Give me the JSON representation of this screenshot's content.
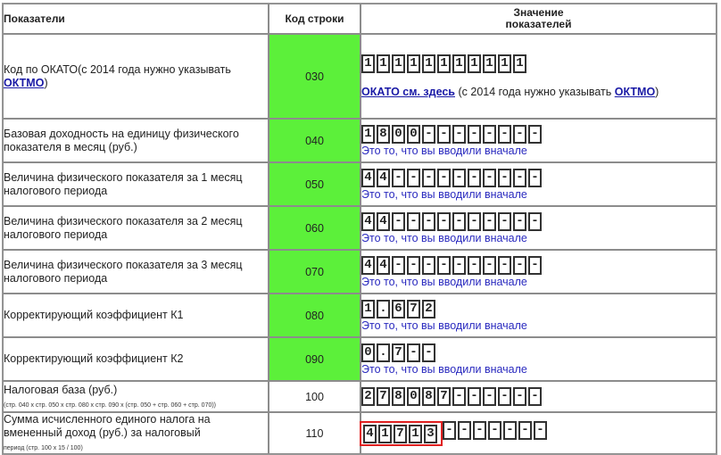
{
  "header": {
    "col1": "Показатели",
    "col2": "Код строки",
    "col3_line1": "Значение",
    "col3_line2": "показателей"
  },
  "okato": {
    "label_prefix": "Код по ОКАТО(с 2014 года нужно указывать ",
    "label_link": "ОКТМО",
    "label_suffix": ")",
    "code": "030",
    "cells": [
      "1",
      "1",
      "1",
      "1",
      "1",
      "1",
      "1",
      "1",
      "1",
      "1",
      "1"
    ],
    "link_text": "ОКАТО см. здесь",
    "after_text": "(с 2014 года нужно указывать ",
    "after_link": "ОКТМО",
    "after_suffix": ")"
  },
  "hint_text": "Это то, что вы вводили вначале",
  "rows": [
    {
      "label": "Базовая доходность на единицу физического показателя в месяц (руб.)",
      "code": "040",
      "cells": [
        "1",
        "8",
        "0",
        "0",
        "-",
        "-",
        "-",
        "-",
        "-",
        "-",
        "-",
        "-"
      ]
    },
    {
      "label": "Величина физического показателя за 1 месяц налогового периода",
      "code": "050",
      "cells": [
        "4",
        "4",
        "-",
        "-",
        "-",
        "-",
        "-",
        "-",
        "-",
        "-",
        "-",
        "-"
      ]
    },
    {
      "label": "Величина физического показателя за 2 месяц налогового периода",
      "code": "060",
      "cells": [
        "4",
        "4",
        "-",
        "-",
        "-",
        "-",
        "-",
        "-",
        "-",
        "-",
        "-",
        "-"
      ]
    },
    {
      "label": "Величина физического показателя за 3 месяц налогового периода",
      "code": "070",
      "cells": [
        "4",
        "4",
        "-",
        "-",
        "-",
        "-",
        "-",
        "-",
        "-",
        "-",
        "-",
        "-"
      ]
    },
    {
      "label": "Корректирующий коэффициент К1",
      "code": "080",
      "cells": [
        "1",
        ".",
        "6",
        "7",
        "2"
      ]
    },
    {
      "label": "Корректирующий коэффициент К2",
      "code": "090",
      "cells": [
        "0",
        ".",
        "7",
        "-",
        "-"
      ]
    }
  ],
  "base": {
    "label": "Налоговая база (руб.)",
    "note": "(стр. 040 x стр. 050 x стр. 080 x стр. 090 x (стр. 050 + стр. 060 + стр. 070))",
    "code": "100",
    "cells": [
      "2",
      "7",
      "8",
      "0",
      "8",
      "7",
      "-",
      "-",
      "-",
      "-",
      "-",
      "-"
    ]
  },
  "sum": {
    "label": "Сумма исчисленного единого налога на вмененный доход (руб.) за налоговый",
    "note": "период (стр. 100 x 15 / 100)",
    "code": "110",
    "cells_highlight": [
      "4",
      "1",
      "7",
      "1",
      "3"
    ],
    "cells_rest": [
      "-",
      "-",
      "-",
      "-",
      "-",
      "-",
      "-"
    ]
  },
  "colors": {
    "code_bg": "#5cf03a",
    "hint": "#2a2abf",
    "highlight": "#e02020"
  }
}
